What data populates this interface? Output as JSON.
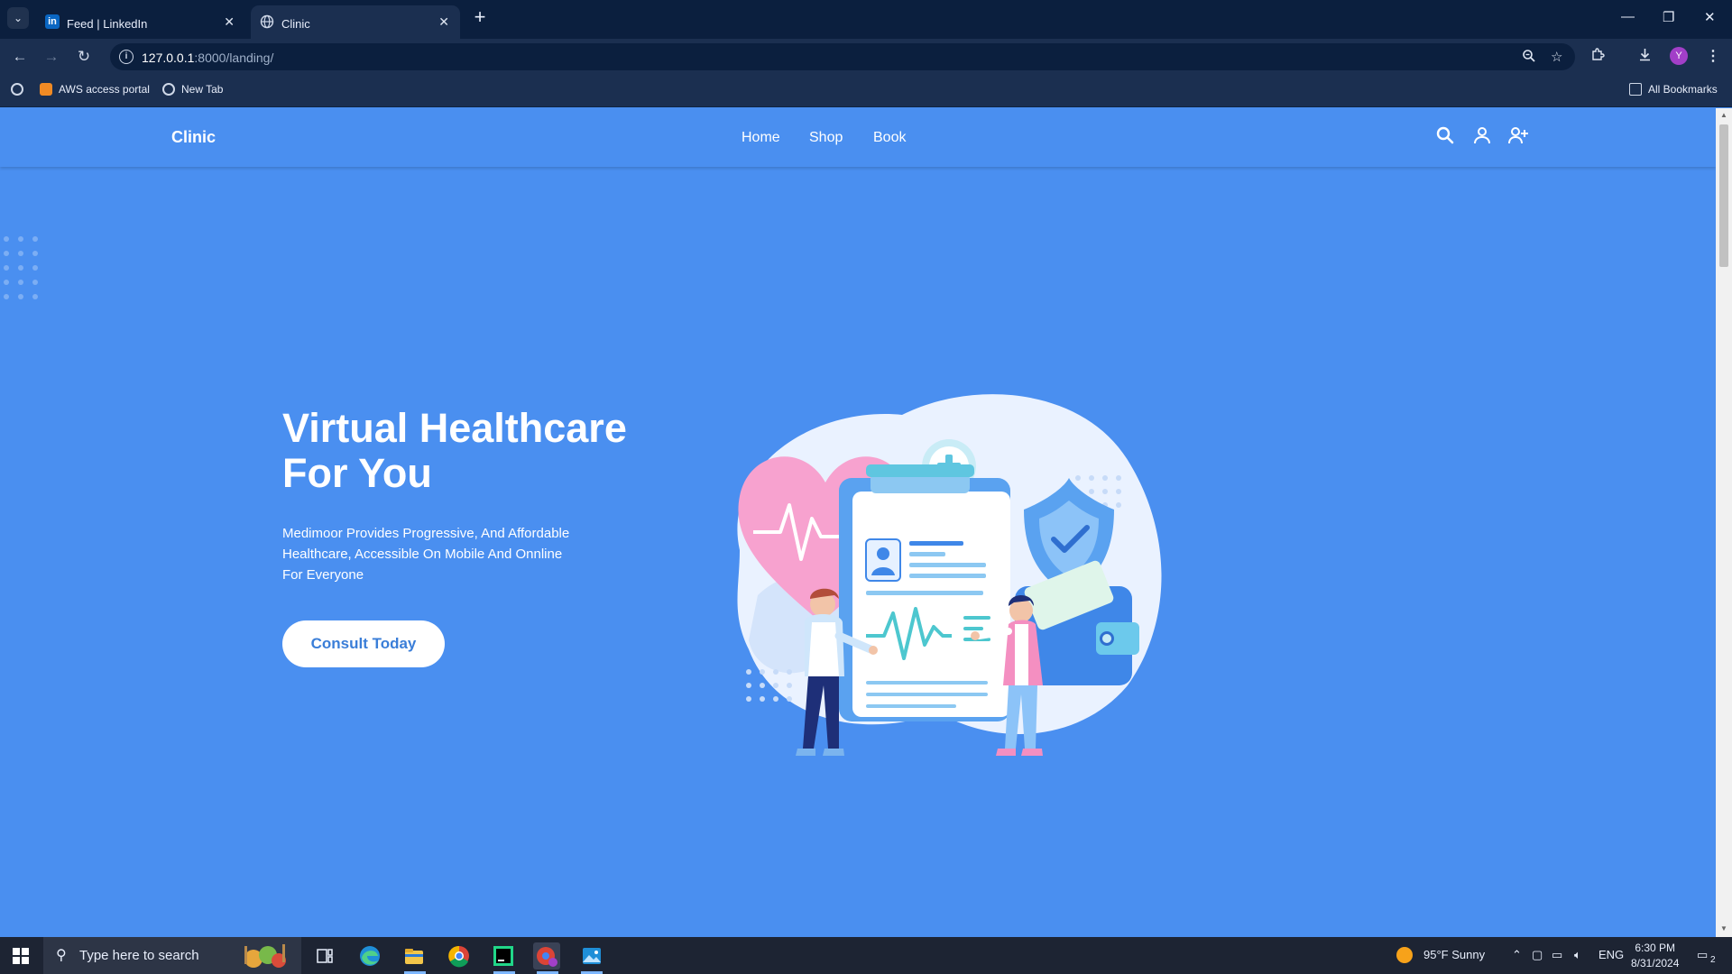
{
  "browser": {
    "tabs": [
      {
        "title": "Feed | LinkedIn",
        "favicon": "in"
      },
      {
        "title": "Clinic"
      }
    ],
    "url_host": "127.0.0.1",
    "url_path": ":8000/landing/",
    "bookmarks": [
      {
        "label": "AWS access portal"
      },
      {
        "label": "New Tab"
      }
    ],
    "all_bookmarks_label": "All Bookmarks",
    "profile_initial": "Y"
  },
  "site": {
    "brand": "Clinic",
    "nav": [
      "Home",
      "Shop",
      "Book"
    ]
  },
  "hero": {
    "title_line1": "Virtual Healthcare",
    "title_line2": "For You",
    "subtitle": "Medimoor Provides Progressive, And Affordable Healthcare, Accessible On Mobile And Onnline For Everyone",
    "cta_label": "Consult Today"
  },
  "taskbar": {
    "search_placeholder": "Type here to search",
    "weather": "95°F  Sunny",
    "language": "ENG",
    "time": "6:30 PM",
    "date": "8/31/2024",
    "notifications": "2"
  },
  "colors": {
    "page_bg": "#4a8ff0",
    "cta_text": "#3a7ed8",
    "chrome_dark": "#0b1f3e",
    "chrome": "#1b2f50"
  }
}
